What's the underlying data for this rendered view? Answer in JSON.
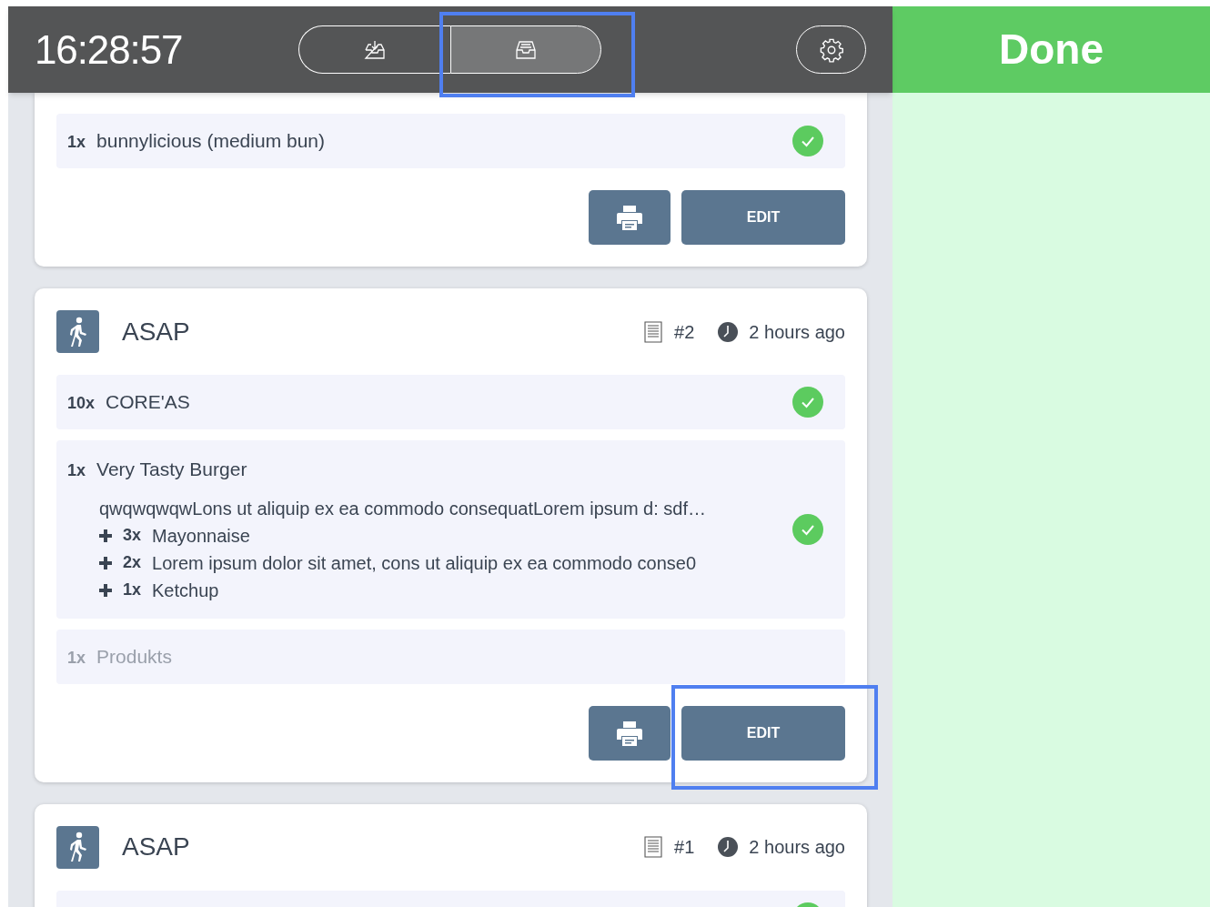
{
  "header": {
    "time": "16:28:57",
    "view_toggle": [
      {
        "selected": false,
        "highlighted": false
      },
      {
        "selected": true,
        "highlighted": true
      }
    ]
  },
  "done_panel": {
    "title": "Done"
  },
  "orders": [
    {
      "items": [
        {
          "qty": "1x",
          "name": "bunnylicious (medium bun)",
          "done": true,
          "unavailable": false
        }
      ],
      "edit_label": "EDIT",
      "edit_highlighted": false
    },
    {
      "header": {
        "title": "ASAP",
        "number": "#2",
        "time": "2 hours ago"
      },
      "items": [
        {
          "qty": "10x",
          "name": "CORE'AS",
          "done": true,
          "unavailable": false
        },
        {
          "qty": "1x",
          "name": "Very Tasty Burger",
          "note": "qwqwqwqwLons ut aliquip ex ea commodo consequatLorem ipsum d: sdf…",
          "modifiers": [
            {
              "qty": "3x",
              "name": "Mayonnaise"
            },
            {
              "qty": "2x",
              "name": "Lorem ipsum dolor sit amet, cons ut aliquip ex ea commodo conse0"
            },
            {
              "qty": "1x",
              "name": "Ketchup"
            }
          ],
          "done": true,
          "unavailable": false
        },
        {
          "qty": "1x",
          "name": "Produkts",
          "done": false,
          "unavailable": true
        }
      ],
      "edit_label": "EDIT",
      "edit_highlighted": true
    },
    {
      "header": {
        "title": "ASAP",
        "number": "#1",
        "time": "2 hours ago"
      },
      "items": [
        {
          "done": true
        }
      ]
    }
  ]
}
